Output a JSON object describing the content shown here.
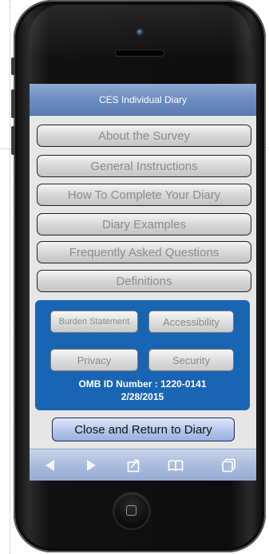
{
  "screen": {
    "title": "CES Individual Diary",
    "menu_items": [
      "About the Survey",
      "General Instructions",
      "How To Complete Your Diary",
      "Diary Examples",
      "Frequently Asked Questions",
      "Definitions"
    ],
    "info_panel": {
      "buttons": [
        "Burden Statement",
        "Accessibility",
        "Privacy",
        "Security"
      ],
      "omb_line": "OMB ID Number : 1220-0141",
      "date_line": "2/28/2015"
    },
    "close_button": "Close and Return to Diary"
  },
  "toolbar": {
    "icons": [
      "back-arrow-icon",
      "forward-arrow-icon",
      "share-icon",
      "bookmarks-icon",
      "tabs-icon"
    ]
  },
  "colors": {
    "title_bar": "#6f8fc2",
    "panel_blue": "#1964b3",
    "toolbar": "#a9bcdc"
  }
}
